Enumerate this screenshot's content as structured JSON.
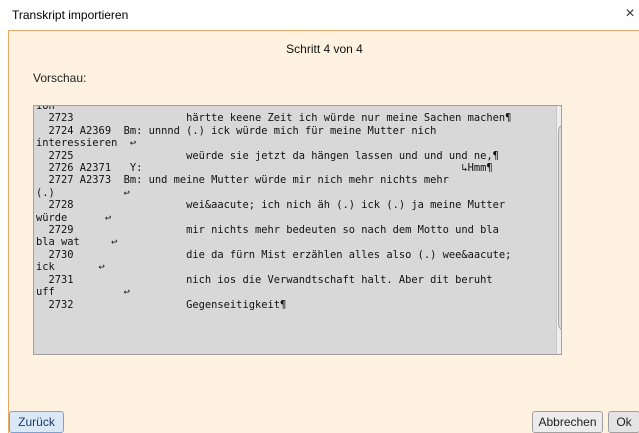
{
  "window": {
    "title": "Transkript importieren",
    "close_symbol": "×"
  },
  "step": "Schritt 4 von 4",
  "preview_label": "Vorschau:",
  "preview_lines": [
    "ion",
    "  2723                  härtte keene Zeit ich würde nur meine Sachen machen¶",
    "  2724 A2369  Bm: unnnd (.) ick würde mich für meine Mutter nich",
    "interessieren  ↩",
    "  2725                  weürde sie jetzt da hängen lassen und und und ne,¶",
    "  2726 A2371   Y:                                                   ↳Hmm¶",
    "  2727 A2373  Bm: und meine Mutter würde mir nich mehr nichts mehr",
    "(.)           ↩",
    "  2728                  wei&aacute; ich nich äh (.) ick (.) ja meine Mutter",
    "würde      ↩",
    "  2729                  mir nichts mehr bedeuten so nach dem Motto und bla",
    "bla wat     ↩",
    "  2730                  die da fürn Mist erzählen alles also (.) wee&aacute;",
    "ick       ↩",
    "  2731                  nich ios die Verwandtschaft halt. Aber dit beruht",
    "uff           ↩",
    "  2732                  Gegenseitigkeit¶"
  ],
  "buttons": {
    "back": "Zurück",
    "cancel": "Abbrechen",
    "ok": "Ok"
  },
  "scrollbar": {
    "up_arrow": "▲",
    "down_arrow": "▼"
  }
}
